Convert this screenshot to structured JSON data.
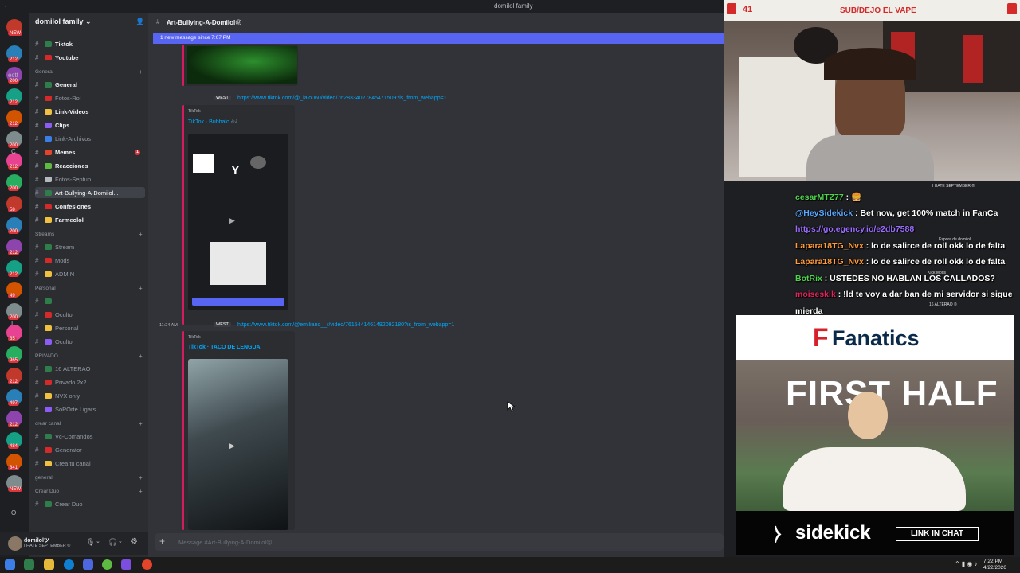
{
  "window": {
    "title": "domilol family"
  },
  "server": {
    "name": "domilol family ⌄"
  },
  "servers_rail": {
    "badges": [
      "NEW",
      "212",
      "200",
      "212",
      "212",
      "200",
      "212",
      "200",
      "58",
      "200",
      "212",
      "212",
      "49",
      "200",
      "35",
      "965",
      "212",
      "497",
      "212",
      "484",
      "341",
      "NEW"
    ],
    "letters": [
      "ectt",
      "C",
      "I",
      "O"
    ]
  },
  "channels": {
    "top": [
      {
        "label": "Tiktok"
      },
      {
        "label": "Youtube"
      }
    ],
    "categories": {
      "general": "General",
      "streams": "Streams",
      "personal": "Personal",
      "privado": "PRIVADO",
      "crear_canal": "crear canal",
      "general2": "general",
      "crear_duo": "Crear Duo"
    },
    "general_items": [
      {
        "label": "General"
      },
      {
        "label": "Fotos-Rol"
      },
      {
        "label": "Link-Videos"
      },
      {
        "label": "Clips"
      },
      {
        "label": "Link-Archivos"
      },
      {
        "label": "Memes",
        "badge": "1"
      },
      {
        "label": "Reacciones"
      },
      {
        "label": "Fotos-Septup"
      },
      {
        "label": "Art-Bullying-A-Domilol..."
      },
      {
        "label": "Confesiones"
      },
      {
        "label": "Farmeolol"
      }
    ],
    "stream_items": [
      {
        "label": "Stream"
      },
      {
        "label": "Mods"
      },
      {
        "label": "ADMIN"
      }
    ],
    "personal_items": [
      {
        "label": ""
      },
      {
        "label": "Oculto"
      },
      {
        "label": "Personal"
      },
      {
        "label": "Oculto"
      }
    ],
    "privado_items": [
      {
        "label": "16 ALTERAO"
      },
      {
        "label": "Privado 2x2"
      },
      {
        "label": "NVX only"
      },
      {
        "label": "SoPOrte Ligars"
      }
    ],
    "crear_items": [
      {
        "label": "Vc-Comandos"
      },
      {
        "label": "Generator"
      },
      {
        "label": "Crea tu canal"
      }
    ],
    "duo_items": [
      {
        "label": "Crear Duo"
      }
    ]
  },
  "user": {
    "name": "domilolツ",
    "status": "I HATE SEPTEMBER ®"
  },
  "chat": {
    "channel_title": "Art-Bullying-A-Domilol😝",
    "new_message_bar": "1 new message since 7:07 PM",
    "messages": [
      {
        "tag": "WEST",
        "link": "https://www.tiktok.com/@_lalo060/video/7628334027845471509?is_from_webapp=1",
        "provider": "TikTok",
        "title": "TikTok · Bubbalo 🎶"
      },
      {
        "time": "11:24 AM",
        "tag": "WEST",
        "link": "https://www.tiktok.com/@emiliano__r/video/7615441461492092180?is_from_webapp=1",
        "provider": "TikTok",
        "title": "TikTok · TACO DE LENGUA"
      }
    ],
    "composer_placeholder": "Message #Art-Bullying-A-Domilol😝"
  },
  "stream_overlay": {
    "topbar_count": "41",
    "topbar_text": "SUB/DEJO EL VAPE",
    "chat": [
      {
        "user": "cesarMTZ77",
        "text": " : 🍔",
        "color": "#4fd34f"
      },
      {
        "user": "@HeySidekick",
        "text": " : Bet now, get 100% match in FanCa",
        "color": "#5aa8ff"
      },
      {
        "user": "",
        "text": "https://go.egency.io/e2db7588",
        "color": "#9b6dff"
      },
      {
        "user": "Lapara18TG_Nvx",
        "text": " : lo de salirce de roll okk lo de falta",
        "color": "#ff9b3a"
      },
      {
        "user": "Lapara18TG_Nvx",
        "text": " : lo de salirce de roll okk lo de falta",
        "color": "#ff9b3a"
      },
      {
        "user": "BotRix",
        "text": " : USTEDES NO HABLAN LOS CALLADOS?",
        "color": "#4fd34f"
      },
      {
        "user": "moiseskik",
        "text": " : !ld te voy a dar ban de mi servidor si sigue",
        "color": "#e0245e"
      },
      {
        "user": "",
        "text": "mierda",
        "color": "#ffffff"
      }
    ],
    "side_labels": [
      "I HATE SEPTEMBER ®",
      "Espora de domilol",
      "Kick Mods",
      "16 ALTERAO ®"
    ]
  },
  "ad": {
    "brand": "Fanatics",
    "headline": "FIRST HALF",
    "sponsor": "sidekick",
    "cta": "LINK IN CHAT"
  },
  "taskbar": {
    "time": "7:22 PM",
    "date": "4/22/2026"
  }
}
